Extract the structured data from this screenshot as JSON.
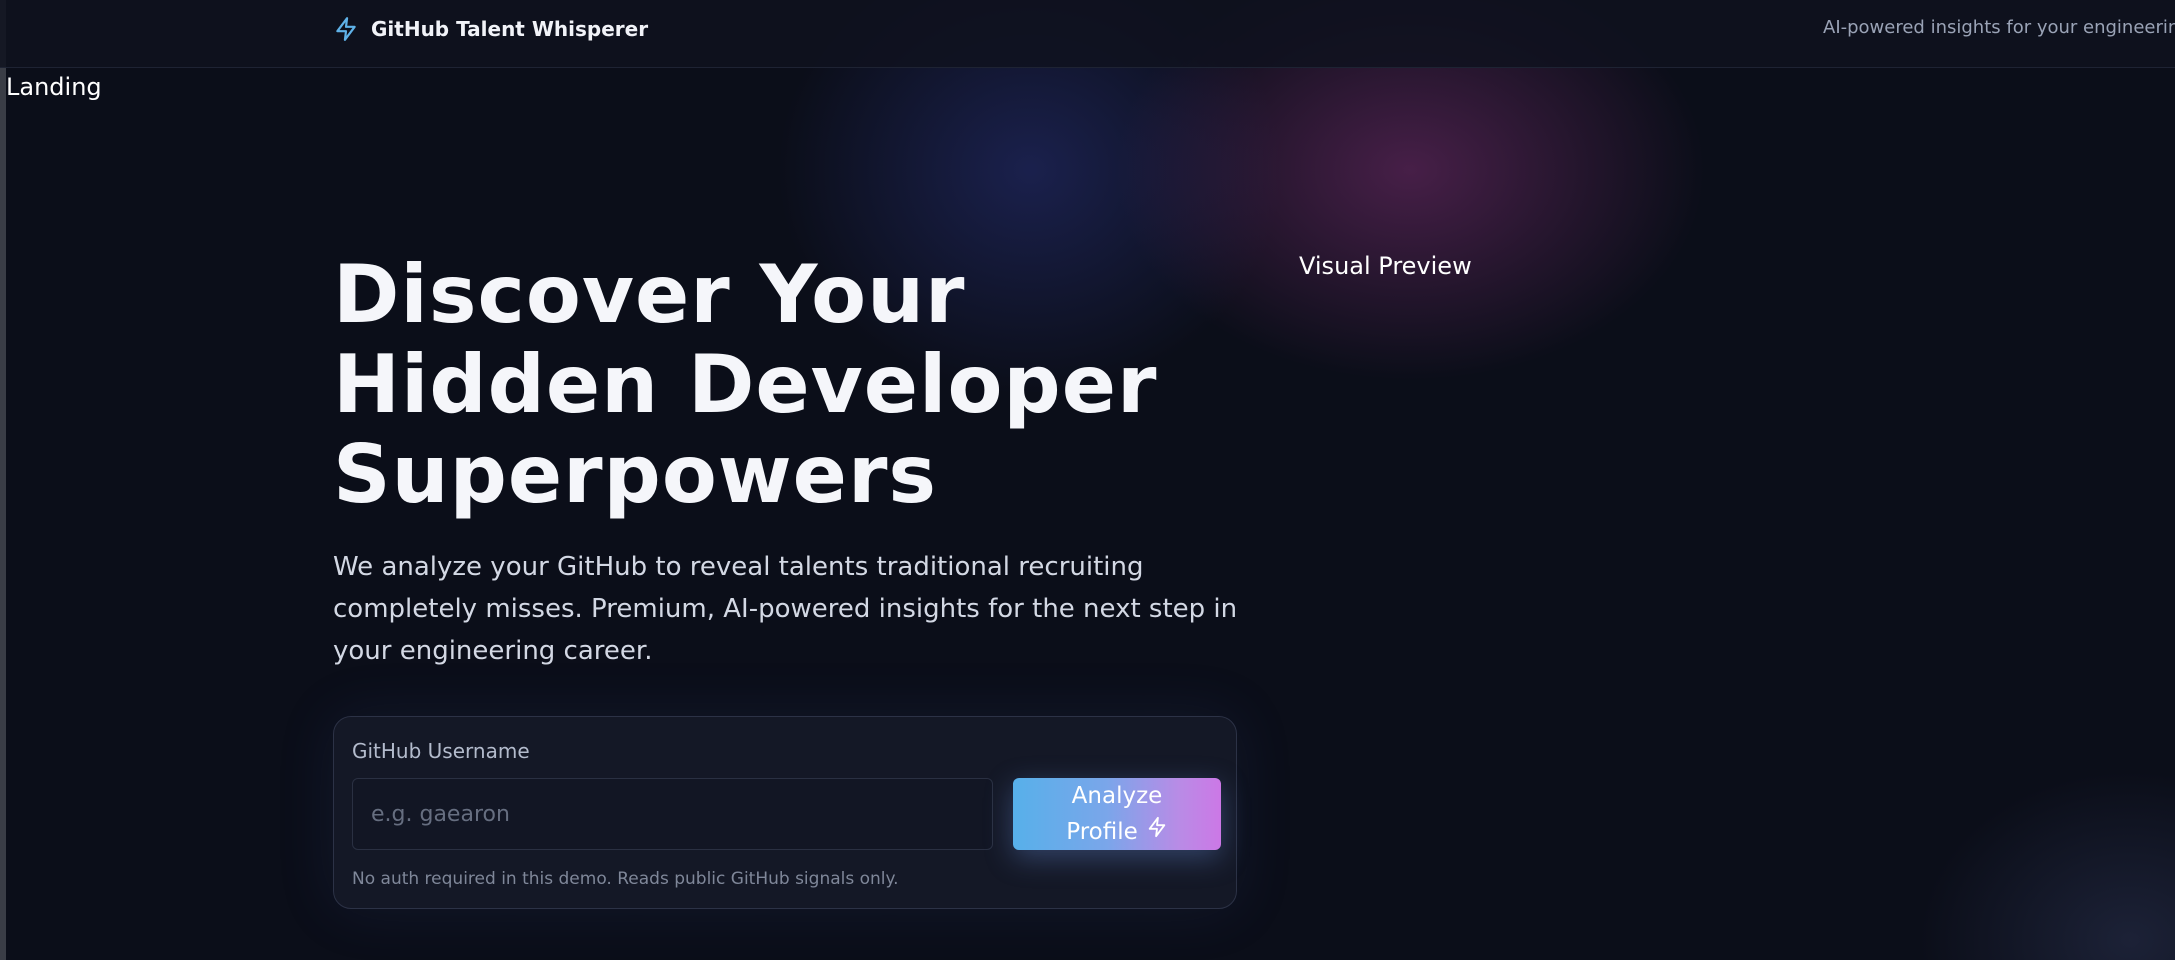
{
  "header": {
    "brand_name": "GitHub Talent Whisperer",
    "brand_icon": "lightning-bolt-icon",
    "tagline": "AI-powered insights for your engineering career"
  },
  "route_label": "Landing",
  "hero": {
    "title_lines": [
      "Discover Your",
      "Hidden Developer",
      "Superpowers"
    ],
    "subtitle": "We analyze your GitHub to reveal talents traditional recruiting completely misses. Premium, AI-powered insights for the next step in your engineering career."
  },
  "preview_label": "Visual Preview",
  "form": {
    "label": "GitHub Username",
    "placeholder": "e.g. gaearon",
    "value": "",
    "button_label": "Analyze Profile",
    "button_icon": "lightning-bolt-icon",
    "note": "No auth required in this demo. Reads public GitHub signals only."
  },
  "colors": {
    "background": "#0b0e19",
    "accent_start": "#57b0ea",
    "accent_end": "#cc78e6",
    "brand_icon": "#5fb2e8"
  }
}
